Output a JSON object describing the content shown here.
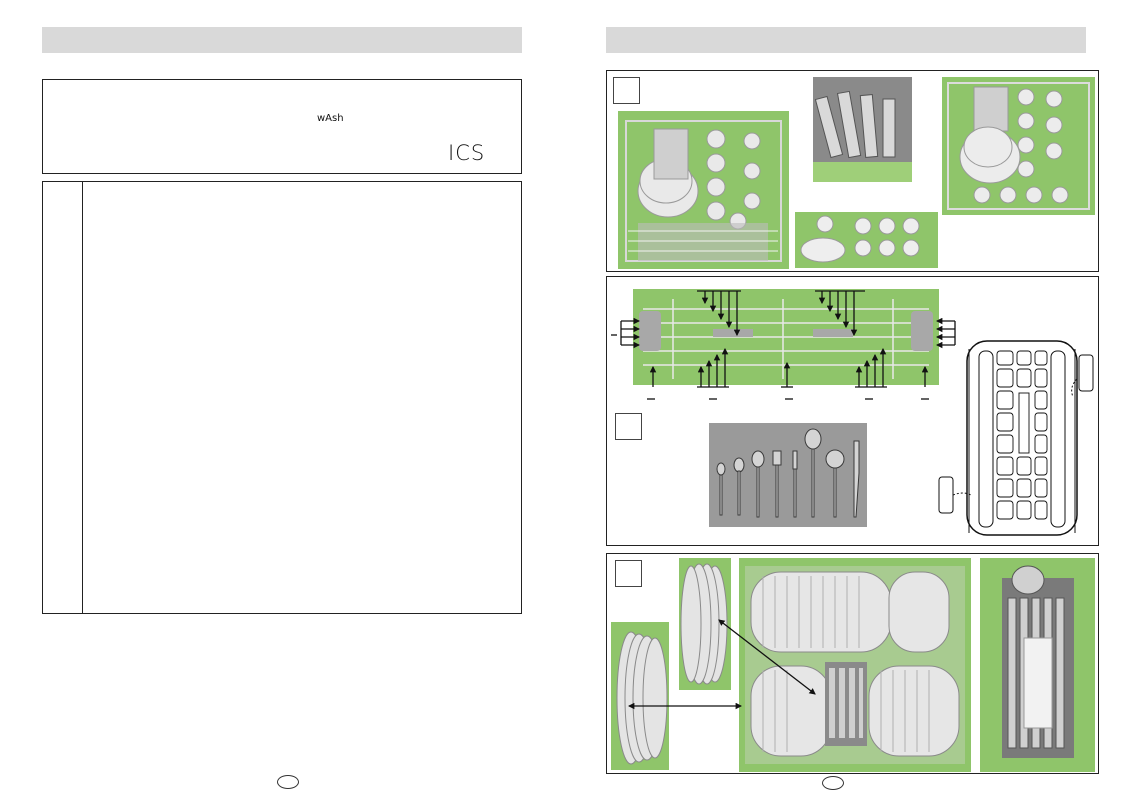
{
  "logos": {
    "wash_logo_text": "wAsh",
    "ics_logo_text": "ICS"
  },
  "colors": {
    "header_bar": "#d9d9d9",
    "photo_green": "#8fc56a",
    "border": "#222222"
  },
  "icons": [
    "moon-wash-icon",
    "ics-logo",
    "arrow-icon",
    "page-number-circle"
  ]
}
